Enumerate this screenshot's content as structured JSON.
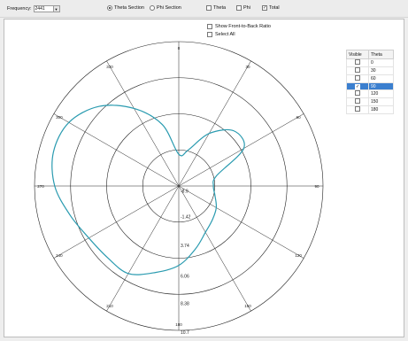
{
  "toolbar": {
    "frequency_label": "Frequency:",
    "frequency_value": "2441",
    "theta_section_label": "Theta Section",
    "phi_section_label": "Phi Section",
    "theta_label": "Theta",
    "phi_label": "Phi",
    "total_label": "Total",
    "mode_selected": "Theta Section",
    "total_checked": true
  },
  "options": {
    "front_to_back_label": "Show Front-to-Back Ratio",
    "select_all_label": "Select All"
  },
  "theta_table": {
    "headers": [
      "Visible",
      "Theta"
    ],
    "rows": [
      {
        "theta": "0",
        "visible": false
      },
      {
        "theta": "30",
        "visible": false
      },
      {
        "theta": "60",
        "visible": false
      },
      {
        "theta": "90",
        "visible": true
      },
      {
        "theta": "120",
        "visible": false
      },
      {
        "theta": "150",
        "visible": false
      },
      {
        "theta": "180",
        "visible": false
      }
    ],
    "selected_row": 3
  },
  "chart_data": {
    "type": "polar-line",
    "angular_tick_labels": [
      "0",
      "330",
      "300",
      "270",
      "240",
      "210",
      "180",
      "150",
      "120",
      "90",
      "60",
      "30"
    ],
    "radial_tick_labels": [
      "-8.9",
      "-1.42",
      "3.74",
      "6.06",
      "8.38",
      "10.7"
    ],
    "radial_range": [
      -8.9,
      10.7
    ],
    "series": [
      {
        "color": "#2a9bb0",
        "angles_deg": [
          0,
          15,
          30,
          45,
          60,
          75,
          90,
          105,
          120,
          135,
          150,
          165,
          180,
          195,
          210,
          225,
          240,
          255,
          270,
          285,
          300,
          315,
          330,
          345
        ],
        "radius_fraction": [
          0.22,
          0.44,
          0.62,
          0.78,
          0.88,
          0.9,
          0.86,
          0.78,
          0.72,
          0.7,
          0.7,
          0.62,
          0.55,
          0.45,
          0.37,
          0.33,
          0.3,
          0.26,
          0.24,
          0.27,
          0.52,
          0.54,
          0.42,
          0.26
        ]
      }
    ],
    "grid": true
  }
}
